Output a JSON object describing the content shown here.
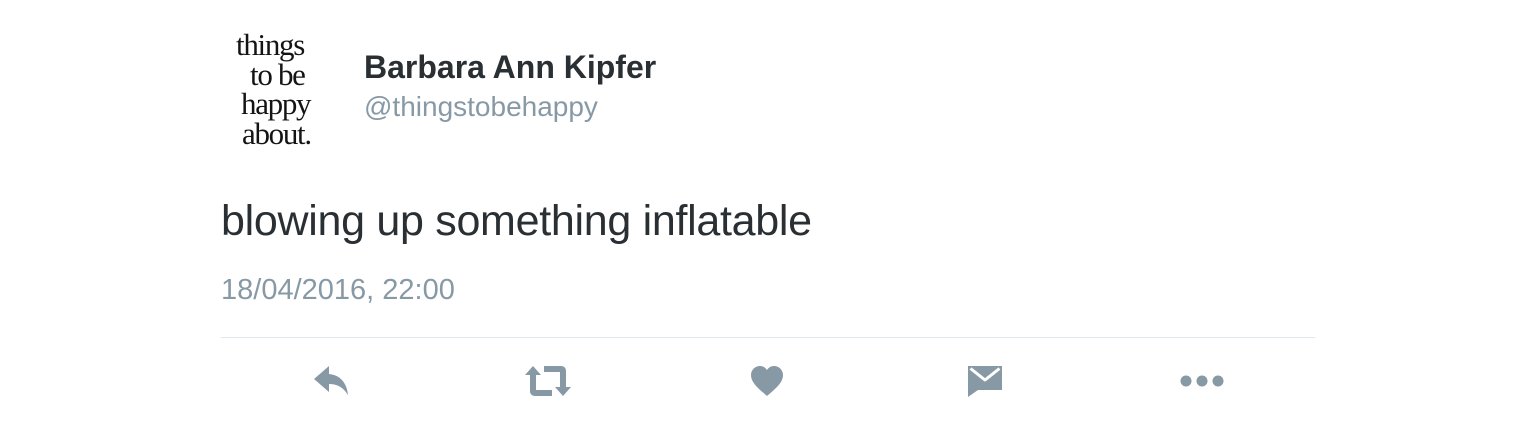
{
  "tweet": {
    "avatar": {
      "logo_lines": [
        "things",
        "to be",
        "happy",
        "about."
      ]
    },
    "author": {
      "display_name": "Barbara Ann Kipfer",
      "handle": "@thingstobehappy"
    },
    "text": "blowing up something inflatable",
    "timestamp": "18/04/2016, 22:00"
  },
  "actions": [
    {
      "icon": "reply-icon"
    },
    {
      "icon": "retweet-icon"
    },
    {
      "icon": "heart-icon"
    },
    {
      "icon": "envelope-icon"
    },
    {
      "icon": "more-icon"
    }
  ],
  "colors": {
    "text_primary": "#292f33",
    "text_secondary": "#8899a6",
    "divider": "#e1e8ed",
    "icon": "#8899a6"
  }
}
